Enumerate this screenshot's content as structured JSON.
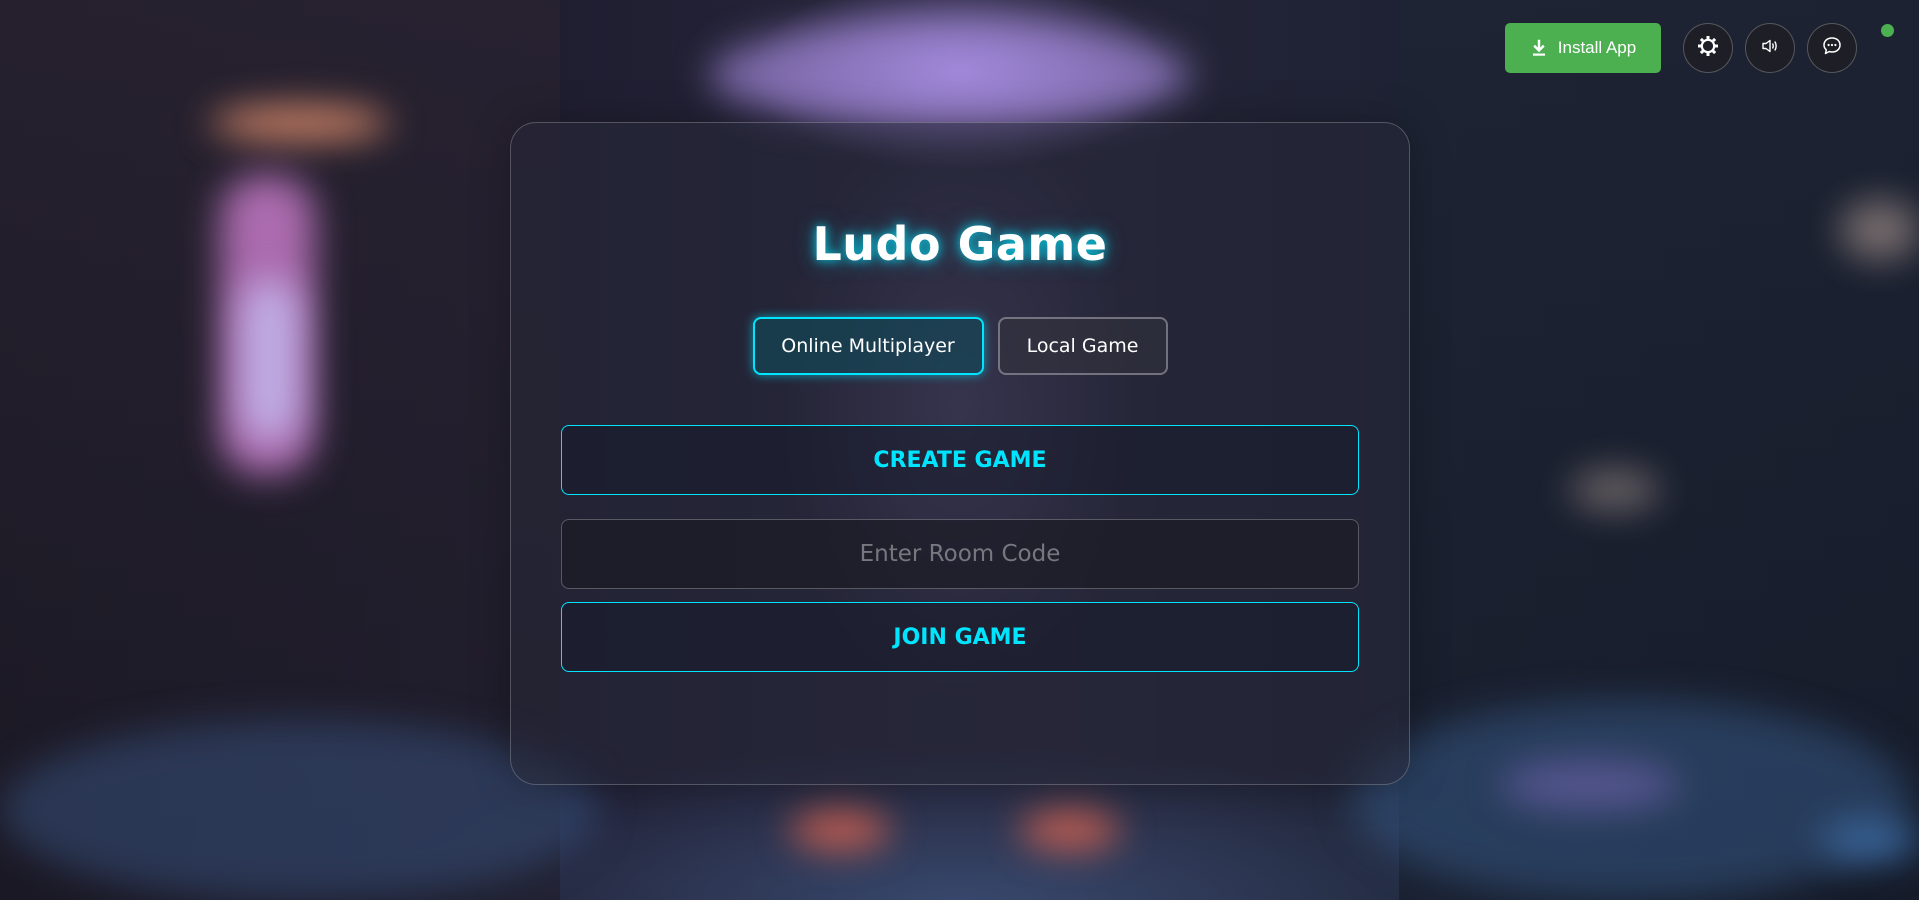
{
  "header": {
    "install_label": "Install App",
    "install_color": "#4caf50",
    "install_icon": "download-icon",
    "settings_icon": "gear-icon",
    "sound_icon": "speaker-icon",
    "chat_icon": "chat-bubble-icon",
    "status_color": "#4caf50"
  },
  "main": {
    "title": "Ludo Game",
    "tabs": [
      {
        "label": "Online Multiplayer",
        "active": true
      },
      {
        "label": "Local Game",
        "active": false
      }
    ],
    "create_label": "CREATE GAME",
    "room_input": {
      "value": "",
      "placeholder": "Enter Room Code"
    },
    "join_label": "JOIN GAME"
  },
  "colors": {
    "accent": "#00e5ff",
    "title_glow": "#00e5ff"
  }
}
